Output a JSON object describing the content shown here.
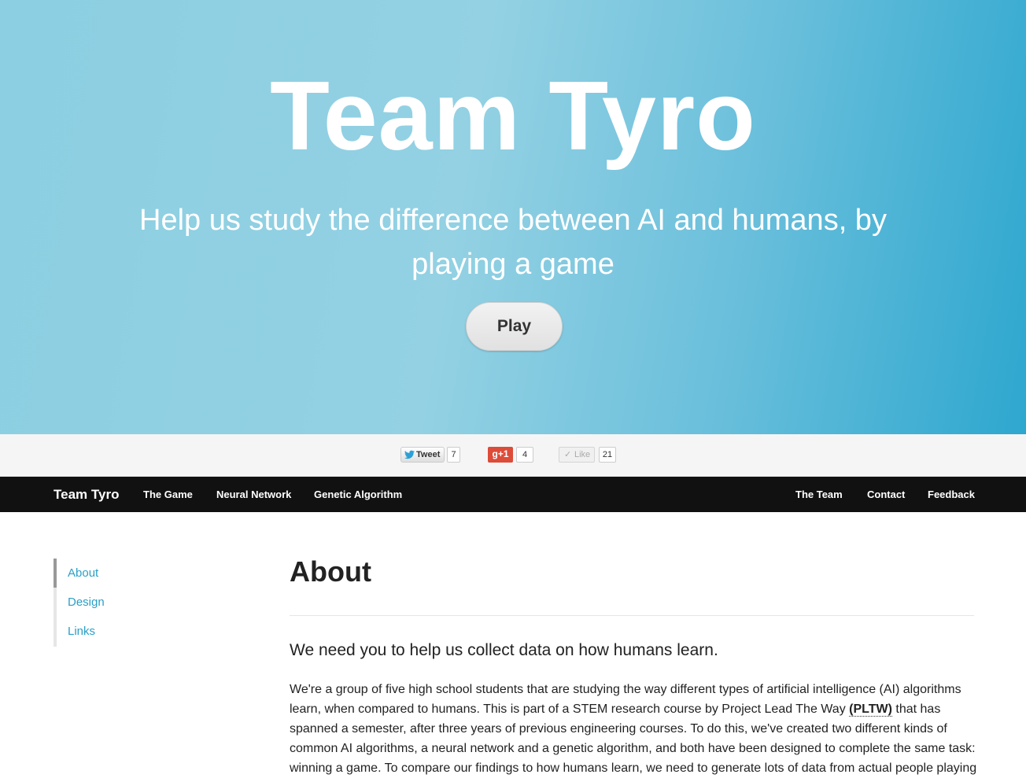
{
  "hero": {
    "title": "Team Tyro",
    "subtitle": "Help us study the difference between AI and humans, by playing a game",
    "play_label": "Play"
  },
  "social": {
    "tweet_label": "Tweet",
    "tweet_count": "7",
    "gplus_label": "+1",
    "gplus_count": "4",
    "like_label": "Like",
    "like_count": "21"
  },
  "navbar": {
    "brand": "Team Tyro",
    "left_links": [
      "The Game",
      "Neural Network",
      "Genetic Algorithm"
    ],
    "right_links": [
      "The Team",
      "Contact",
      "Feedback"
    ]
  },
  "sidebar": {
    "items": [
      "About",
      "Design",
      "Links"
    ],
    "active": "About"
  },
  "main": {
    "title": "About",
    "lead": "We need you to help us collect data on how humans learn.",
    "paragraph_part1": "We're a group of five high school students that are studying the way different types of artificial intelligence (AI) algorithms learn, when compared to humans. This is part of a STEM research course by Project Lead The Way ",
    "paragraph_abbr": "(PLTW)",
    "paragraph_part2": " that has spanned a semester, after three years of previous engineering courses. To do this, we've created two different kinds of common AI algorithms, a neural network and a genetic algorithm, and both have been designed to complete the same task: winning a game. To compare our findings to how humans learn, we need to generate lots of data from actual people playing"
  },
  "colors": {
    "link_accent": "#2aa0c6",
    "navbar_bg": "#111111",
    "gplus_red": "#dd4b39"
  }
}
